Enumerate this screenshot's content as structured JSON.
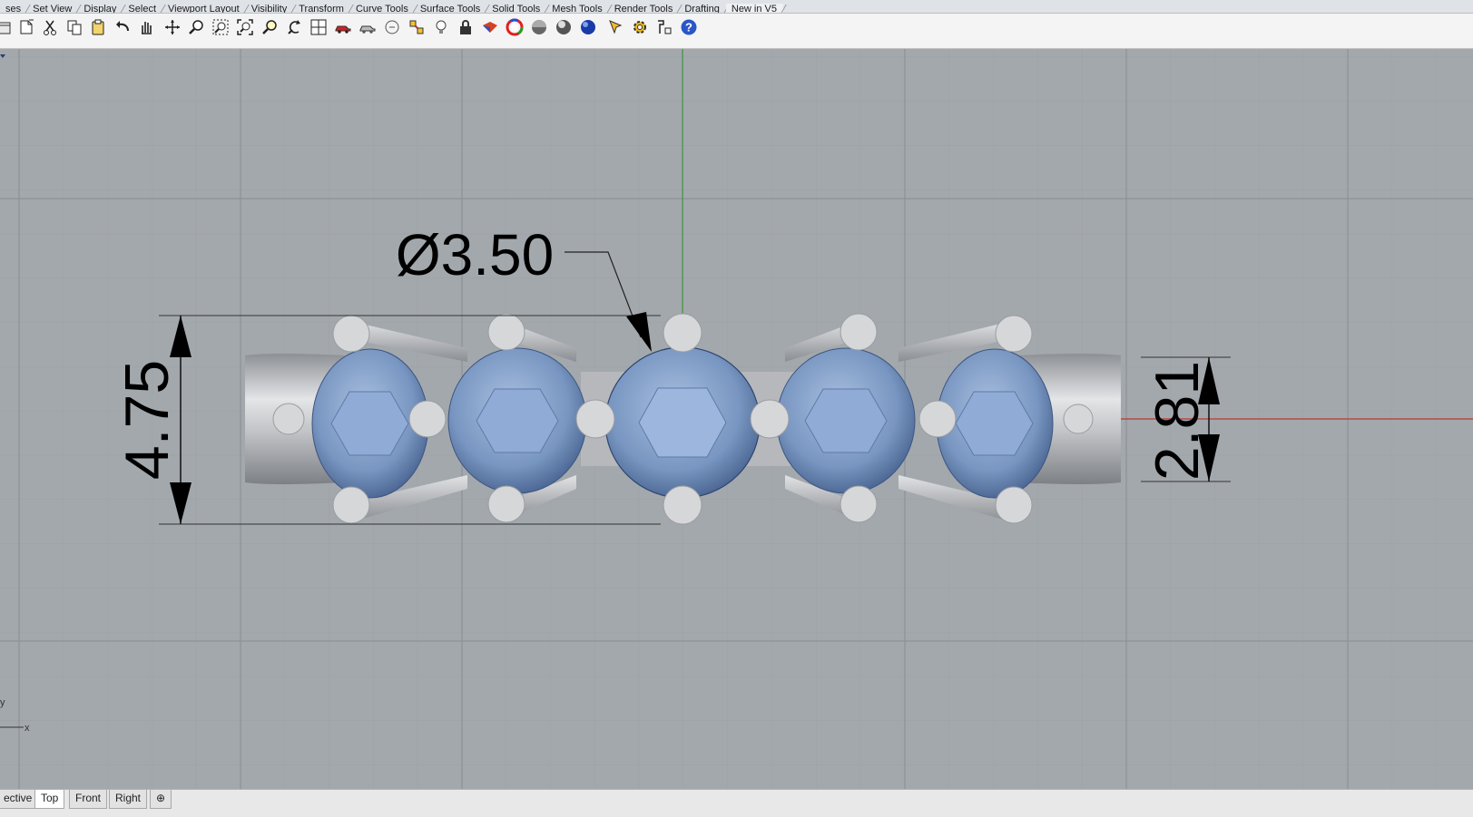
{
  "menu_tabs": [
    "ses",
    "Set View",
    "Display",
    "Select",
    "Viewport Layout",
    "Visibility",
    "Transform",
    "Curve Tools",
    "Surface Tools",
    "Solid Tools",
    "Mesh Tools",
    "Render Tools",
    "Drafting",
    "New in V5"
  ],
  "toolbar_icons": [
    "open-icon",
    "new-page-icon",
    "cut-icon",
    "copy-icon",
    "paste-icon",
    "undo-icon",
    "pan-hand-icon",
    "rotate-view-icon",
    "zoom-icon",
    "zoom-window-icon",
    "zoom-extents-icon",
    "zoom-selected-icon",
    "undo-view-icon",
    "four-viewports-icon",
    "car-render-icon",
    "car-wireframe-icon",
    "circle-view-icon",
    "object-snap-icon",
    "light-bulb-icon",
    "lock-icon",
    "shade-icon",
    "color-wheel-icon",
    "sphere-shaded-icon",
    "sphere-rendered-icon",
    "sphere-blue-icon",
    "arrow-select-icon",
    "gear-options-icon",
    "properties-icon",
    "help-icon"
  ],
  "viewport": {
    "background": "#a3a8ad",
    "grid_color": "#9aa0a5",
    "major_grid_color": "#8e9499",
    "x_axis_color": "#b8392f",
    "y_axis_color": "#3e9a3a",
    "gem_color": "#7b98c2",
    "metal_color": "#c4c6c9"
  },
  "dimensions": {
    "diameter_label": "Ø3.50",
    "height_label": "4.75",
    "depth_label": "2.81"
  },
  "axis_labels": {
    "x": "x",
    "y": "y"
  },
  "viewport_tabs": {
    "perspective": "ective",
    "top": "Top",
    "front": "Front",
    "right": "Right",
    "add": "⊕"
  },
  "active_viewport_tab": "Top"
}
